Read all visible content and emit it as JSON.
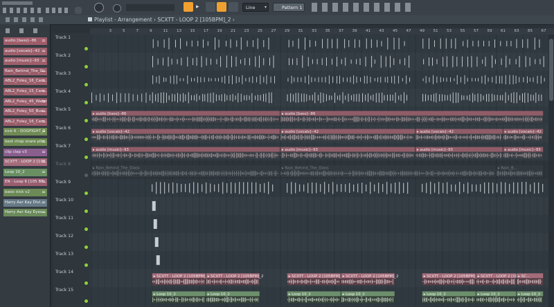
{
  "toolbar": {
    "tempo_mode": "Line",
    "pattern": "Pattern 1"
  },
  "titlebar": {
    "breadcrumb": "Playlist - Arrangement  ›  SCXTT - LOOP 2 [105BPM]_2  ›"
  },
  "ruler": {
    "bars": [
      "3",
      "5",
      "7",
      "9",
      "11",
      "13",
      "15",
      "17",
      "19",
      "21",
      "23",
      "25",
      "27",
      "29",
      "31",
      "33",
      "35",
      "37",
      "39",
      "41",
      "43",
      "45",
      "47",
      "49",
      "51",
      "53",
      "55",
      "57",
      "59",
      "61",
      "63",
      "65",
      "67"
    ]
  },
  "picker": [
    {
      "label": "audio [bass]--86",
      "color": "#9f5d6a"
    },
    {
      "label": "audio [vocals]--42",
      "color": "#9d5f6c"
    },
    {
      "label": "audio [music]--93",
      "color": "#9e5f6b"
    },
    {
      "label": "Rain_Behind_The_G...",
      "color": "#9a5c69"
    },
    {
      "label": "ABL2_Foley_16_Carr...",
      "color": "#9c5e6a"
    },
    {
      "label": "ABL2_Foley_15_Carr...",
      "color": "#9a5d6a"
    },
    {
      "label": "ABL2_Foley_45_Water",
      "color": "#9b5d6a"
    },
    {
      "label": "ABL2_Foley_50_Bus...",
      "color": "#9b5e6b"
    },
    {
      "label": "ABL2_Foley_16_Carr...",
      "color": "#9a5c69"
    },
    {
      "label": "kick 6 - DOGFIGHT_2",
      "color": "#6f8a53"
    },
    {
      "label": "best chop snare pitc...",
      "color": "#6e8a52"
    },
    {
      "label": "clip clap v3",
      "color": "#8a5f8e"
    },
    {
      "label": "SCXTT - LOOP 2 [105...",
      "color": "#a46b7a"
    },
    {
      "label": "Loop 10_2",
      "color": "#6a8f63"
    },
    {
      "label": "EN - Loop 6 [105 BP...",
      "color": "#9a5e70"
    },
    {
      "label": "basic kick v2",
      "color": "#6c8a56"
    },
    {
      "label": "Harry Aar Kay Divi...",
      "color": "#677a86"
    },
    {
      "label": "Harry Aar Kay Eyes...",
      "color": "#6b8a5a"
    }
  ],
  "tracks": [
    "Track 1",
    "Track 2",
    "Track 3",
    "Track 4",
    "Track 5",
    "Track 6",
    "Track 7",
    "Track 8",
    "Track 9",
    "Track 10",
    "Track 11",
    "Track 12",
    "Track 13",
    "Track 14",
    "Track 15"
  ],
  "clips": {
    "bass": [
      {
        "label": "audio [bass]--86",
        "bar": 1,
        "len": 28
      },
      {
        "label": "audio [bass]--86",
        "bar": 29,
        "len": 39
      }
    ],
    "vocals": [
      {
        "label": "audio [vocals]--42",
        "bar": 1,
        "len": 28
      },
      {
        "label": "audio [vocals]--42",
        "bar": 29,
        "len": 20
      },
      {
        "label": "audio [vocals]--42",
        "bar": 49,
        "len": 13
      },
      {
        "label": "audio [vocals]--42",
        "bar": 62,
        "len": 6
      }
    ],
    "music": [
      {
        "label": "audio [music]--93",
        "bar": 1,
        "len": 28
      },
      {
        "label": "audio [music]--93",
        "bar": 29,
        "len": 20
      },
      {
        "label": "audio [music]--93",
        "bar": 49,
        "len": 13
      },
      {
        "label": "audio [music]--93",
        "bar": 62,
        "len": 6
      }
    ],
    "rain": [
      {
        "label": "Rain_Behind_The_Glass",
        "bar": 1,
        "len": 28
      },
      {
        "label": "Rain_Behind_The_Glass",
        "bar": 29,
        "len": 32
      },
      {
        "label": "Rain_B...",
        "bar": 61,
        "len": 7
      }
    ],
    "scxtt": [
      {
        "label": "SCXTT - LOOP 2 [105BPM]_2",
        "bar": 10,
        "len": 8
      },
      {
        "label": "SCXTT - LOOP 2 [105BPM]_2",
        "bar": 18,
        "len": 8
      },
      {
        "label": "SCXTT - LOOP 2 [105BPM]_2",
        "bar": 30,
        "len": 8
      },
      {
        "label": "SCXTT - LOOP 2 [105BPM]_2",
        "bar": 38,
        "len": 8
      },
      {
        "label": "SCXTT - LOOP 2 [105BPM]_2",
        "bar": 50,
        "len": 8
      },
      {
        "label": "SCXTT - LOOP 2 [105BPM]_2",
        "bar": 58,
        "len": 6
      },
      {
        "label": "SC...",
        "bar": 64,
        "len": 4
      }
    ],
    "loop10": [
      {
        "label": "Loop 10_2",
        "bar": 10,
        "len": 8
      },
      {
        "label": "Loop 10_2",
        "bar": 18,
        "len": 8
      },
      {
        "label": "Loop 10_2",
        "bar": 30,
        "len": 8
      },
      {
        "label": "Loop 10_2",
        "bar": 38,
        "len": 8
      },
      {
        "label": "Loop 10_2",
        "bar": 50,
        "len": 8
      },
      {
        "label": "Loop 10_2",
        "bar": 58,
        "len": 6
      },
      {
        "label": "Loop 10_2",
        "bar": 64,
        "len": 4
      }
    ]
  },
  "colors": {
    "accent": "#f0a030",
    "led": "#8fd03a",
    "clip_audio": "#a56874",
    "clip_loop": "#6d8f6c",
    "clip_rain": "#7b848a",
    "led_dim": "#56606a"
  }
}
